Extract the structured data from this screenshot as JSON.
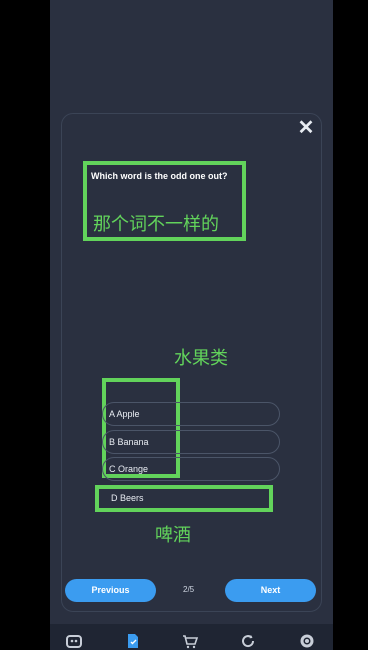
{
  "question": {
    "text": "Which word is the odd one out?",
    "annotation": "那个词不一样的"
  },
  "annotations": {
    "fruits": "水果类",
    "beer": "啤酒"
  },
  "options": [
    {
      "label": "A Apple"
    },
    {
      "label": "B Banana"
    },
    {
      "label": "C Orange"
    },
    {
      "label": "D Beers"
    }
  ],
  "nav": {
    "previous": "Previous",
    "next": "Next",
    "page_indicator": "2/5"
  },
  "bottom_nav": [
    {
      "icon": "robot-icon"
    },
    {
      "icon": "document-icon"
    },
    {
      "icon": "cart-icon"
    },
    {
      "icon": "refresh-icon"
    },
    {
      "icon": "gear-icon"
    }
  ],
  "colors": {
    "highlight": "#62d35b",
    "button": "#3b9cf0",
    "background": "#2a3040"
  }
}
